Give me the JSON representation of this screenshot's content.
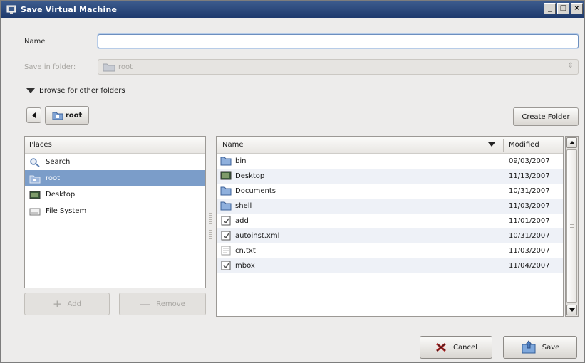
{
  "window": {
    "title": "Save Virtual Machine",
    "controls": [
      "_",
      "□",
      "×"
    ]
  },
  "form": {
    "name_label": "Name",
    "name_value": "",
    "save_in_folder_label": "Save in folder:",
    "save_in_folder_value": "root"
  },
  "browse": {
    "expander_label": "Browse for other folders"
  },
  "pathbar": {
    "current": "root",
    "create_folder_label": "Create Folder"
  },
  "places": {
    "header": "Places",
    "items": [
      {
        "label": "Search",
        "icon": "search-icon",
        "selected": false
      },
      {
        "label": "root",
        "icon": "home-folder-icon",
        "selected": true
      },
      {
        "label": "Desktop",
        "icon": "desktop-icon",
        "selected": false
      },
      {
        "label": "File System",
        "icon": "drive-icon",
        "selected": false
      }
    ],
    "add_label": "Add",
    "remove_label": "Remove"
  },
  "files": {
    "col_name": "Name",
    "col_modified": "Modified",
    "rows": [
      {
        "name": "bin",
        "modified": "09/03/2007",
        "type": "folder"
      },
      {
        "name": "Desktop",
        "modified": "11/13/2007",
        "type": "desktop"
      },
      {
        "name": "Documents",
        "modified": "10/31/2007",
        "type": "folder"
      },
      {
        "name": "shell",
        "modified": "11/03/2007",
        "type": "folder"
      },
      {
        "name": "add",
        "modified": "11/01/2007",
        "type": "script"
      },
      {
        "name": "autoinst.xml",
        "modified": "10/31/2007",
        "type": "script"
      },
      {
        "name": "cn.txt",
        "modified": "11/03/2007",
        "type": "text"
      },
      {
        "name": "mbox",
        "modified": "11/04/2007",
        "type": "script"
      }
    ]
  },
  "actions": {
    "cancel_label": "Cancel",
    "save_label": "Save"
  }
}
